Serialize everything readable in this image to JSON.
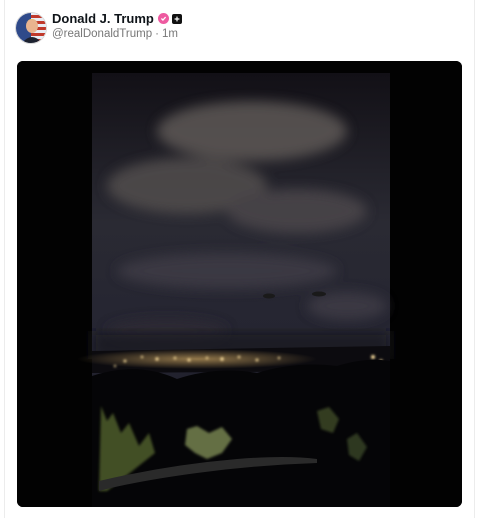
{
  "post": {
    "display_name": "Donald J. Trump",
    "handle": "@realDonaldTrump",
    "separator": "·",
    "time": "1m"
  },
  "icons": {
    "verified": "verified-badge-icon",
    "affiliation": "affiliation-plus-icon"
  },
  "colors": {
    "verified_badge": "#ee5aa0",
    "name_text": "#0f1419",
    "meta_text": "#777777",
    "media_background": "#020202"
  }
}
